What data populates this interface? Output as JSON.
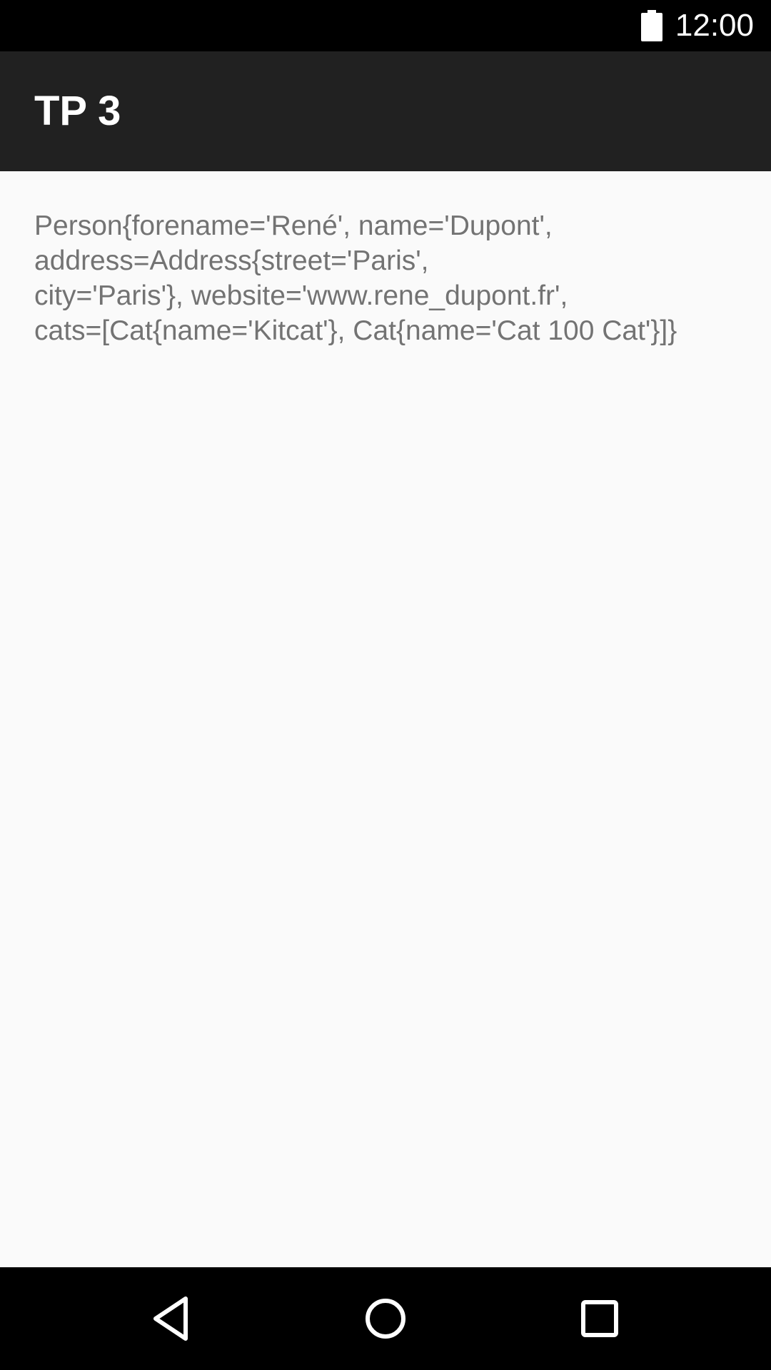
{
  "status_bar": {
    "time": "12:00",
    "battery_icon": "battery-full-icon"
  },
  "app_bar": {
    "title": "TP 3"
  },
  "content": {
    "text": "Person{forename='René', name='Dupont',\naddress=Address{street='Paris',\ncity='Paris'}, website='www.rene_dupont.fr',\ncats=[Cat{name='Kitcat'}, Cat{name='Cat 100 Cat'}]}"
  },
  "nav_bar": {
    "back_icon": "back-triangle-icon",
    "home_icon": "home-circle-icon",
    "recents_icon": "recents-square-icon"
  },
  "colors": {
    "status_bar_bg": "#000000",
    "app_bar_bg": "#212121",
    "content_bg": "#fafafa",
    "text": "#737373",
    "nav_bar_bg": "#000000"
  }
}
